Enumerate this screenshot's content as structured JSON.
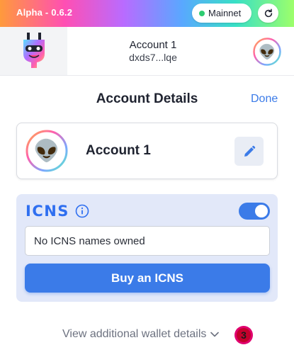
{
  "topbar": {
    "version": "Alpha - 0.6.2",
    "network_label": "Mainnet",
    "network_status_color": "#2ecc71",
    "refresh_icon": "refresh-icon"
  },
  "header": {
    "logo_icon": "plug-mascot-logo",
    "account_name": "Account 1",
    "account_address": "dxds7...lqe",
    "avatar_emoji": "👽"
  },
  "page": {
    "title": "Account Details",
    "done_label": "Done"
  },
  "account_card": {
    "avatar_emoji": "👽",
    "name": "Account 1",
    "edit_icon": "pencil-icon"
  },
  "icns": {
    "logo_text": "ICNS",
    "info_icon": "info-icon",
    "toggle_on": true,
    "status_text": "No ICNS names owned",
    "buy_button_label": "Buy an ICNS"
  },
  "footer": {
    "details_label": "View additional wallet details",
    "badge_count": "3"
  },
  "colors": {
    "accent": "#3b7be8",
    "icns_panel_bg": "#e2e8f9",
    "badge": "#e0006e"
  }
}
